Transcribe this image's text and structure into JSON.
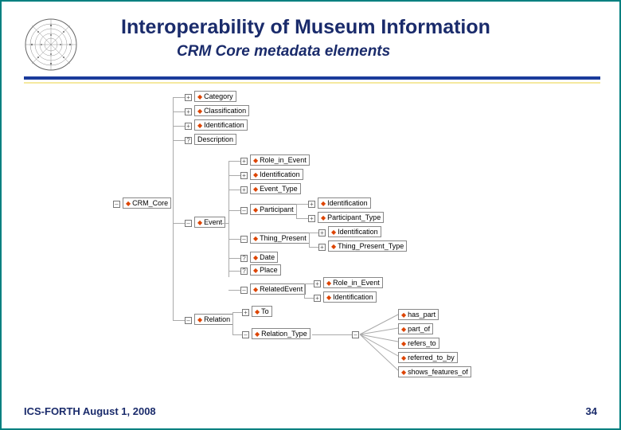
{
  "header": {
    "title": "Interoperability of Museum Information",
    "subtitle": "CRM Core metadata elements"
  },
  "footer": {
    "text": "ICS-FORTH  August 1, 2008",
    "page": "34"
  },
  "tree": {
    "root": "CRM_Core",
    "nodes": {
      "category": "Category",
      "classification": "Classification",
      "identification": "Identification",
      "description": "Description",
      "role_in_event": "Role_in_Event",
      "ev_identification": "Identification",
      "event_type": "Event_Type",
      "participant": "Participant",
      "p_identification": "Identification",
      "participant_type": "Participant_Type",
      "thing_present": "Thing_Present",
      "tp_identification": "Identification",
      "thing_present_type": "Thing_Present_Type",
      "event": "Event",
      "date": "Date",
      "place": "Place",
      "related_event": "RelatedEvent",
      "re_role_in_event": "Role_in_Event",
      "re_identification": "Identification",
      "to": "To",
      "relation_type": "Relation_Type",
      "relation": "Relation",
      "has_part": "has_part",
      "part_of": "part_of",
      "refers_to": "refers_to",
      "referred_to_by": "referred_to_by",
      "shows_features_of": "shows_features_of"
    }
  }
}
